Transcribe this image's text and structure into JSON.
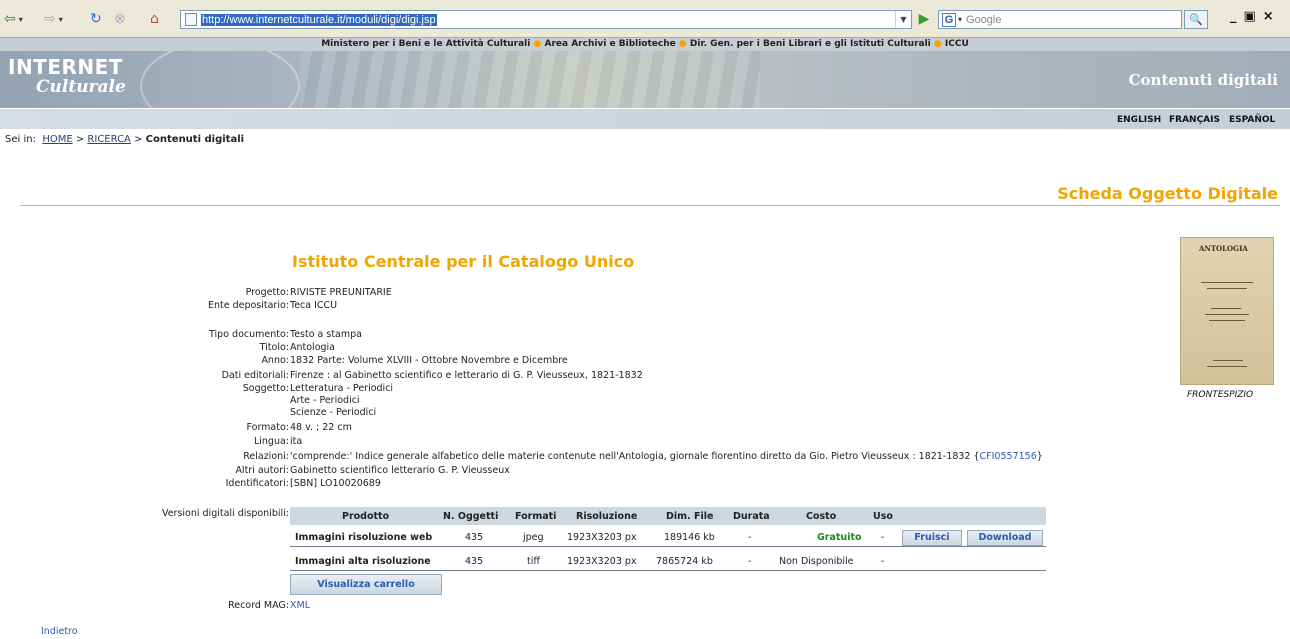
{
  "browser": {
    "url": "http://www.internetculturale.it/moduli/digi/digi.jsp",
    "search_placeholder": "Google",
    "google_glyph": "G"
  },
  "site": {
    "ministries": [
      "Ministero per i Beni e le Attività Culturali",
      "Area Archivi e Biblioteche",
      "Dir. Gen. per i Beni Librari e gli Istituti Culturali",
      "ICCU"
    ],
    "logo_line1": "INTERNET",
    "logo_line2": "Culturale",
    "banner_title": "Contenuti digitali",
    "languages": [
      "ENGLISH",
      "FRANÇAIS",
      "ESPAÑOL"
    ]
  },
  "breadcrumb": {
    "prefix": "Sei in:",
    "home": "HOME",
    "ricerca": "RICERCA",
    "current": "Contenuti digitali",
    "sep": ">"
  },
  "page_title": "Scheda Oggetto Digitale",
  "institute": "Istituto Centrale per il Catalogo Unico",
  "thumbnail": {
    "caption": "FRONTESPIZIO",
    "title_text": "ANTOLOGIA"
  },
  "metadata": {
    "progetto": {
      "label": "Progetto:",
      "value": "RIVISTE PREUNITARIE"
    },
    "ente": {
      "label": "Ente depositario:",
      "value": "Teca ICCU"
    },
    "tipo": {
      "label": "Tipo documento:",
      "value": "Testo a stampa"
    },
    "titolo": {
      "label": "Titolo:",
      "value": "Antologia"
    },
    "anno": {
      "label": "Anno:",
      "value": "1832 Parte: Volume XLVIII - Ottobre Novembre e Dicembre"
    },
    "dati": {
      "label": "Dati editoriali:",
      "value": "Firenze : al Gabinetto scientifico e letterario di G. P. Vieusseux, 1821-1832"
    },
    "soggetto": {
      "label": "Soggetto:",
      "values": [
        "Letteratura - Periodici",
        "Arte - Periodici",
        "Scienze - Periodici"
      ]
    },
    "formato": {
      "label": "Formato:",
      "value": "48 v. ; 22 cm"
    },
    "lingua": {
      "label": "Lingua:",
      "value": "ita"
    },
    "relazioni": {
      "label": "Relazioni:",
      "value": "'comprende:' Indice generale alfabetico delle materie contenute nell'Antologia, giornale fiorentino diretto da Gio. Pietro Vieusseux : 1821-1832 {",
      "link": "CFI0557156",
      "tail": "}"
    },
    "altri": {
      "label": "Altri autori:",
      "value": "Gabinetto scientifico letterario G. P. Vieusseux"
    },
    "ident": {
      "label": "Identificatori:",
      "value": "[SBN] LO10020689"
    },
    "versioni": {
      "label": "Versioni digitali disponibili:"
    },
    "mag": {
      "label": "Record MAG:",
      "link": "XML"
    }
  },
  "versions_table": {
    "headers": [
      "Prodotto",
      "N. Oggetti",
      "Formati",
      "Risoluzione",
      "Dim. File",
      "Durata",
      "Costo",
      "Uso"
    ],
    "rows": [
      {
        "prodotto": "Immagini risoluzione web",
        "n": "435",
        "formato": "jpeg",
        "risoluzione": "1923X3203 px",
        "dim": "189146 kb",
        "durata": "-",
        "costo": "Gratuito",
        "uso": "-"
      },
      {
        "prodotto": "Immagini alta risoluzione",
        "n": "435",
        "formato": "tiff",
        "risoluzione": "1923X3203 px",
        "dim": "7865724 kb",
        "durata": "-",
        "costo": "Non Disponibile",
        "uso": "-"
      }
    ],
    "fruisci_label": "Fruisci",
    "download_label": "Download",
    "cart_label": "Visualizza carrello"
  },
  "back_link": "Indietro",
  "colors": {
    "accent": "#f0a500",
    "link": "#2a5db0",
    "free": "#1e8a1e"
  }
}
